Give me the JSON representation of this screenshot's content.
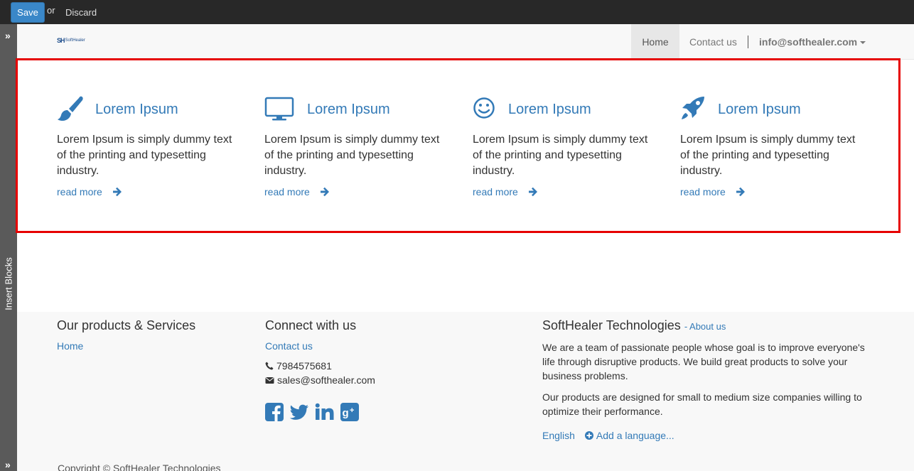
{
  "editor": {
    "save_label": "Save",
    "or_label": "or",
    "discard_label": "Discard"
  },
  "rail": {
    "top_arrow": "»",
    "bottom_arrow": "»",
    "insert_blocks_label": "Insert Blocks"
  },
  "navbar": {
    "logo_mark": "SH",
    "logo_text": "SoftHealer",
    "home_label": "Home",
    "contact_label": "Contact us",
    "user_label": "info@softhealer.com"
  },
  "features": [
    {
      "icon": "paint-brush-icon",
      "title": "Lorem Ipsum",
      "description": "Lorem Ipsum is simply dummy text of the printing and typesetting industry.",
      "more": "read more"
    },
    {
      "icon": "desktop-icon",
      "title": "Lorem Ipsum",
      "description": "Lorem Ipsum is simply dummy text of the printing and typesetting industry.",
      "more": "read more"
    },
    {
      "icon": "smile-icon",
      "title": "Lorem Ipsum",
      "description": "Lorem Ipsum is simply dummy text of the printing and typesetting industry.",
      "more": "read more"
    },
    {
      "icon": "rocket-icon",
      "title": "Lorem Ipsum",
      "description": "Lorem Ipsum is simply dummy text of the printing and typesetting industry.",
      "more": "read more"
    }
  ],
  "footer": {
    "products": {
      "heading": "Our products & Services",
      "home_link": "Home"
    },
    "connect": {
      "heading": "Connect with us",
      "contact_link": "Contact us",
      "phone": "7984575681",
      "email": "sales@softhealer.com",
      "social_icons": [
        "facebook-icon",
        "twitter-icon",
        "linkedin-icon",
        "google-plus-icon"
      ]
    },
    "about": {
      "heading": "SoftHealer Technologies",
      "about_link": "- About us",
      "paragraph1": "We are a team of passionate people whose goal is to improve everyone's life through disruptive products. We build great products to solve your business problems.",
      "paragraph2": "Our products are designed for small to medium size companies willing to optimize their performance.",
      "language": "English",
      "add_language": "Add a language..."
    },
    "copyright": "Copyright © SoftHealer Technologies"
  },
  "colors": {
    "accent": "#337ab7",
    "highlight_frame": "#e60000",
    "editor_bar": "#282828",
    "save_button": "#3a87c8"
  }
}
